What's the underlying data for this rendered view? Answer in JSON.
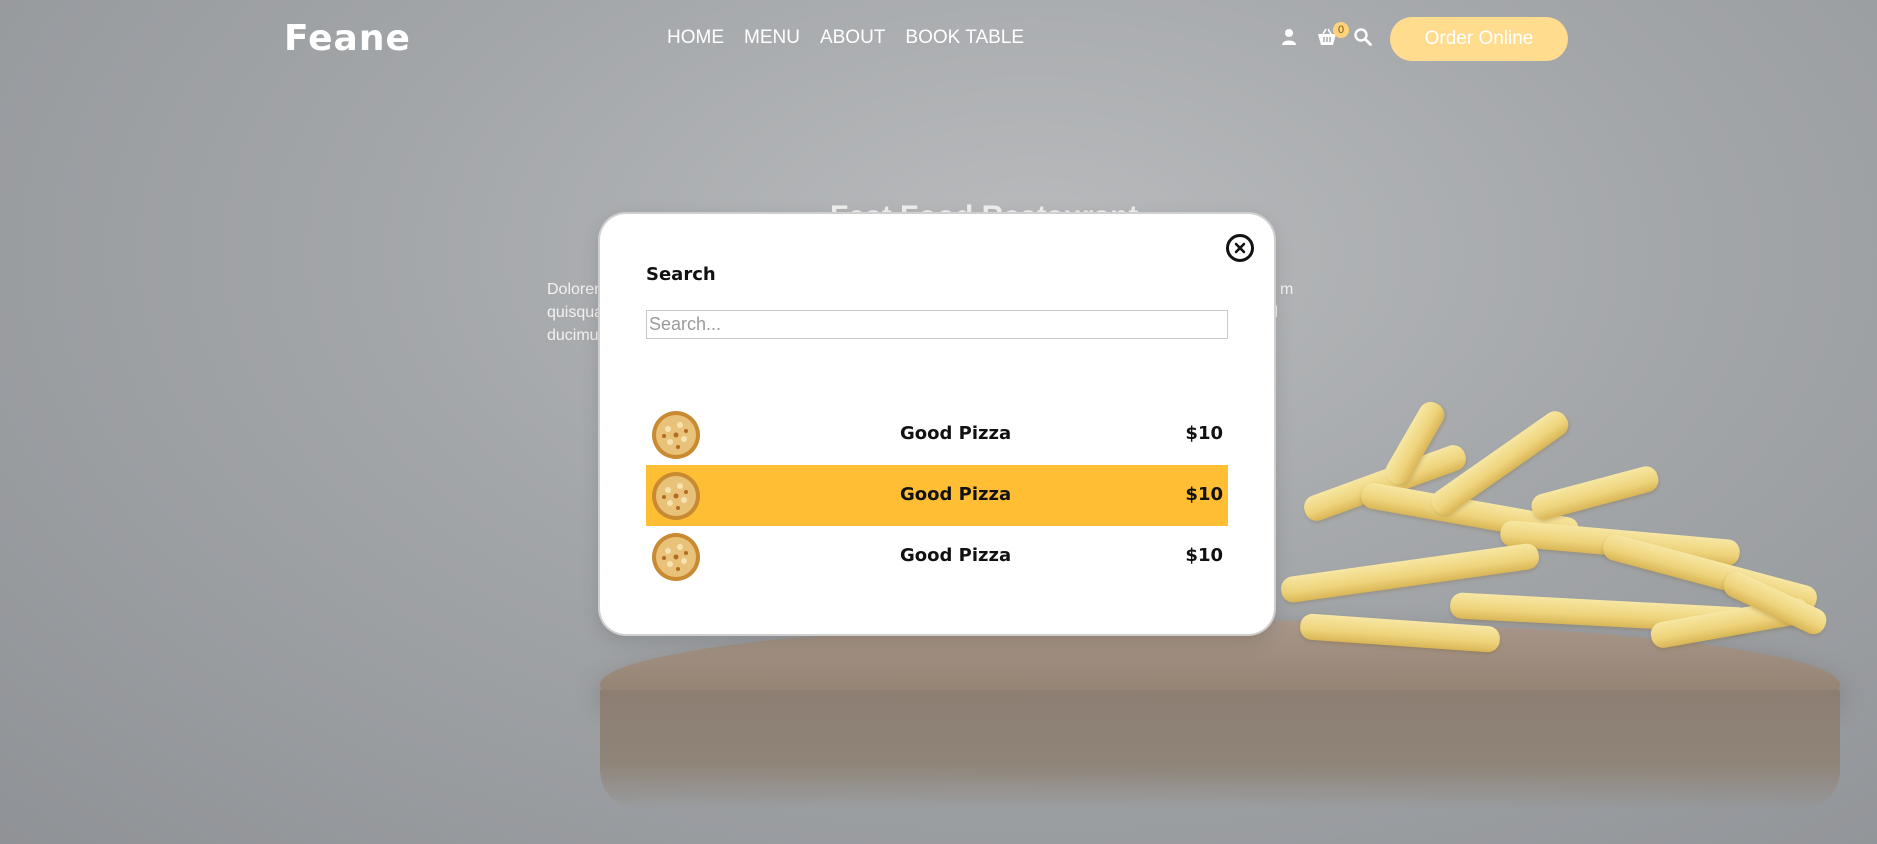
{
  "header": {
    "logo": "Feane",
    "nav": [
      "HOME",
      "MENU",
      "ABOUT",
      "BOOK TABLE"
    ],
    "cart_count": "0",
    "order_button": "Order Online"
  },
  "hero": {
    "title": "Fast Food Restaurant",
    "text_line1": "Dolorem",
    "text_line2": "quisqua",
    "text_line3": "ducimu",
    "text_right1": "m",
    "text_right2": "hil"
  },
  "modal": {
    "title": "Search",
    "search_placeholder": "Search...",
    "results": [
      {
        "name": "Good Pizza",
        "price": "$10",
        "active": false
      },
      {
        "name": "Good Pizza",
        "price": "$10",
        "active": true
      },
      {
        "name": "Good Pizza",
        "price": "$10",
        "active": false
      }
    ]
  },
  "colors": {
    "accent": "#ffbe33",
    "order_button": "#ffdc8e",
    "overlay": "#9fa2a5"
  },
  "icons": [
    "user-icon",
    "cart-icon",
    "search-icon",
    "close-icon",
    "pizza-thumbnail"
  ]
}
